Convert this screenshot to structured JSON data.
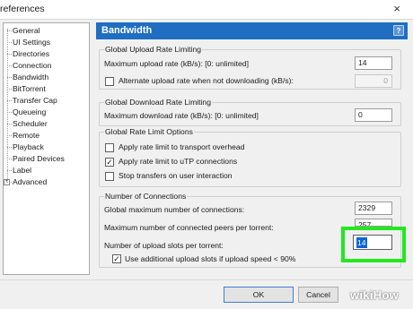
{
  "window": {
    "title": "references",
    "close_glyph": "×"
  },
  "tree": {
    "items": [
      "General",
      "UI Settings",
      "Directories",
      "Connection",
      "Bandwidth",
      "BitTorrent",
      "Transfer Cap",
      "Queueing",
      "Scheduler",
      "Remote",
      "Playback",
      "Paired Devices",
      "Label",
      "Advanced"
    ],
    "expander_glyph": "+"
  },
  "panel": {
    "title": "Bandwidth",
    "help_glyph": "?"
  },
  "upload": {
    "group": "Global Upload Rate Limiting",
    "max_label": "Maximum upload rate (kB/s): [0: unlimited]",
    "max_value": "14",
    "alt_label": "Alternate upload rate when not downloading (kB/s):",
    "alt_checked": false,
    "alt_value": "0"
  },
  "download": {
    "group": "Global Download Rate Limiting",
    "max_label": "Maximum download rate (kB/s): [0: unlimited]",
    "max_value": "0"
  },
  "options": {
    "group": "Global Rate Limit Options",
    "items": [
      {
        "label": "Apply rate limit to transport overhead",
        "checked": false
      },
      {
        "label": "Apply rate limit to uTP connections",
        "checked": true
      },
      {
        "label": "Stop transfers on user interaction",
        "checked": false
      }
    ]
  },
  "connections": {
    "group": "Number of Connections",
    "global_label": "Global maximum number of connections:",
    "global_value": "2329",
    "peers_label": "Maximum number of connected peers per torrent:",
    "peers_value": "257",
    "slots_label": "Number of upload slots per torrent:",
    "slots_value": "14",
    "extra_label": "Use additional upload slots if upload speed < 90%",
    "extra_checked": true
  },
  "check_glyph": "✓",
  "buttons": {
    "ok": "OK",
    "cancel": "Cancel"
  },
  "watermark": "wikiHow",
  "colors": {
    "header": "#1f6ec2",
    "highlight": "#22e81f",
    "selection": "#0a64d8"
  }
}
